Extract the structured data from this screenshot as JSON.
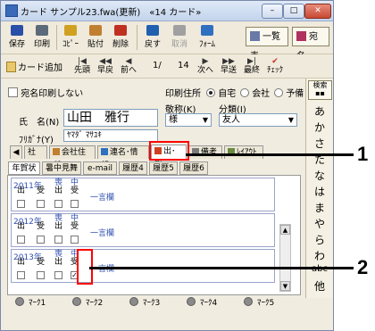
{
  "window": {
    "title": "カード サンプル23.fwa(更新)　«14 カード»",
    "min": "–",
    "max": "□",
    "close": "✕"
  },
  "toolbar1": {
    "buttons": [
      {
        "label": "保存",
        "icon": "floppy-icon",
        "color": "#2a4fa8"
      },
      {
        "label": "印刷",
        "icon": "printer-icon",
        "color": "#5a6a7a"
      },
      {
        "label": "ｺﾋﾟｰ",
        "icon": "copy-icon",
        "color": "#d0a020"
      },
      {
        "label": "貼付",
        "icon": "paste-icon",
        "color": "#c08030"
      },
      {
        "label": "削除",
        "icon": "delete-icon",
        "color": "#c03020"
      },
      {
        "label": "戻す",
        "icon": "undo-icon",
        "color": "#2060b0"
      },
      {
        "label": "取消",
        "icon": "redo-icon",
        "color": "#a0a0a0",
        "disabled": true
      },
      {
        "label": "ﾌｫｰﾑ",
        "icon": "form-icon",
        "color": "#3070c0"
      }
    ],
    "list_button": "一覧表",
    "address_button": "宛名"
  },
  "toolbar2": {
    "add_card": "カード追加",
    "first": "先頭",
    "prev_fast": "早戻",
    "prev": "前へ",
    "position": "1/",
    "total": "14",
    "next": "次へ",
    "next_fast": "早送",
    "last": "最終",
    "check": "ﾁｪｯｸ"
  },
  "form": {
    "no_print_label": "宛名印刷しない",
    "print_address_label": "印刷住所",
    "radio_options": [
      "自宅",
      "会社",
      "予備"
    ],
    "radio_selected": 0,
    "name_label": "氏　名(N)",
    "name_value": "山田　雅行",
    "furigana_label": "ﾌﾘｶﾞﾅ(Y)",
    "furigana_value": "ﾔﾏﾀﾞ ﾏｻﾕｷ",
    "honorific_label": "敬称(K)",
    "honorific_value": "様",
    "category_label": "分類(I)",
    "category_value": "友人"
  },
  "tabs": [
    "社",
    "会社住所",
    "連名･情報",
    "出･受",
    "備考",
    "ﾚｲｱｳﾄ"
  ],
  "active_tab": 3,
  "subtabs": [
    "年賀状",
    "暑中見舞",
    "e-mail",
    "履歴4",
    "履歴5",
    "履歴6"
  ],
  "active_subtab": 0,
  "rows": [
    {
      "year": "2011年",
      "memo": "一言欄",
      "checked": [
        false,
        false,
        false,
        false
      ]
    },
    {
      "year": "2012年",
      "memo": "一言欄",
      "checked": [
        false,
        false,
        false,
        false
      ]
    },
    {
      "year": "2013年",
      "memo": "一言欄",
      "checked": [
        false,
        false,
        false,
        true
      ]
    }
  ],
  "column_heads": [
    {
      "top": "旧",
      "bottom": "出"
    },
    {
      "top": "",
      "bottom": "受"
    },
    {
      "top": "喪",
      "bottom": "出"
    },
    {
      "top": "中",
      "bottom": "受"
    }
  ],
  "marks": [
    "ﾏｰｸ1",
    "ﾏｰｸ2",
    "ﾏｰｸ3",
    "ﾏｰｸ4",
    "ﾏｰｸ5"
  ],
  "index": {
    "search_label": "検索",
    "kana": [
      "あ",
      "か",
      "さ",
      "た",
      "な",
      "は",
      "ま",
      "や",
      "ら",
      "わ",
      "abc",
      "他"
    ]
  },
  "callouts": [
    "1",
    "2"
  ]
}
